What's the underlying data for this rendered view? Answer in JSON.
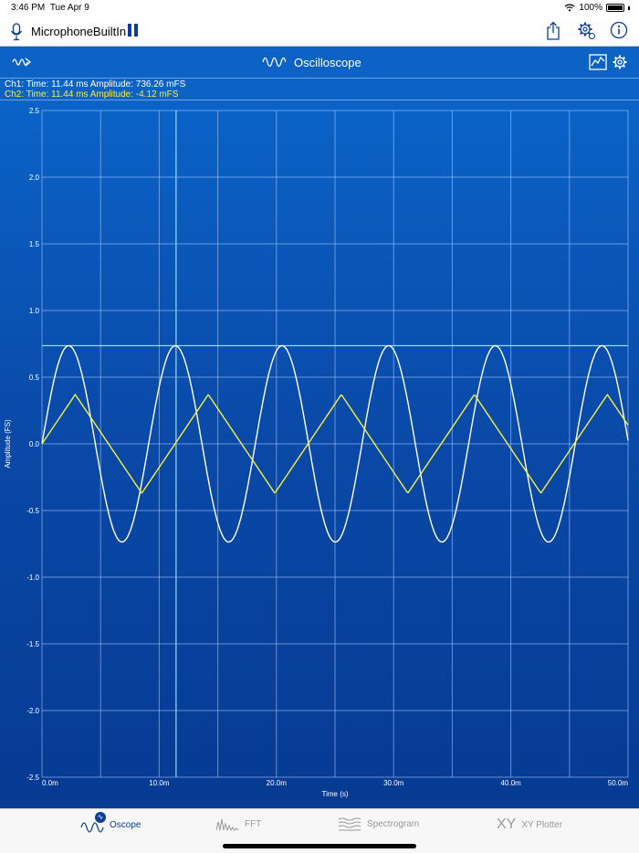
{
  "status": {
    "time": "3:46 PM",
    "date": "Tue Apr 9",
    "battery": "100%"
  },
  "toolbar": {
    "source": "MicrophoneBuiltIn"
  },
  "titlebar": {
    "title": "Oscilloscope"
  },
  "readout": {
    "ch1": "Ch1:  Time: 11.44 ms  Amplitude: 736.26 mFS",
    "ch2": "Ch2:  Time: 11.44 ms  Amplitude: -4.12 mFS"
  },
  "tabs": [
    {
      "label": "Oscope",
      "active": true
    },
    {
      "label": "FFT",
      "active": false
    },
    {
      "label": "Spectrogram",
      "active": false
    },
    {
      "label": "XY Plotter",
      "active": false
    }
  ],
  "colors": {
    "accent": "#0d62c6",
    "ch1": "#ffffff",
    "ch2": "#f7f040",
    "cursor": "#8fdcff"
  },
  "chart_data": {
    "type": "line",
    "xlabel": "Time (s)",
    "ylabel": "Amplitude (FS)",
    "xlim": [
      0,
      50
    ],
    "ylim": [
      -2.5,
      2.5
    ],
    "xticks": [
      0,
      5,
      10,
      15,
      20,
      25,
      30,
      35,
      40,
      45,
      50
    ],
    "xtick_labels": [
      "0.0m",
      "",
      "10.0m",
      "",
      "20.0m",
      "",
      "30.0m",
      "",
      "40.0m",
      "",
      "50.0m"
    ],
    "yticks": [
      2.5,
      2.0,
      1.5,
      1.0,
      0.5,
      0.0,
      -0.5,
      -1.0,
      -1.5,
      -2.0,
      -2.5
    ],
    "ytick_labels": [
      "2.5",
      "2.0",
      "1.5",
      "1.0",
      "0.5",
      "0.0",
      "-0.5",
      "-1.0",
      "-1.5",
      "-2.0",
      "-2.5"
    ],
    "cursor": {
      "x": 11.44,
      "y": 0.73626
    },
    "series": [
      {
        "name": "Ch1",
        "shape": "sine",
        "amplitude": 0.736,
        "period": 9.1,
        "phase": 0
      },
      {
        "name": "Ch2",
        "shape": "triangle",
        "amplitude": 0.37,
        "period": 11.35,
        "phase": 0
      }
    ]
  }
}
